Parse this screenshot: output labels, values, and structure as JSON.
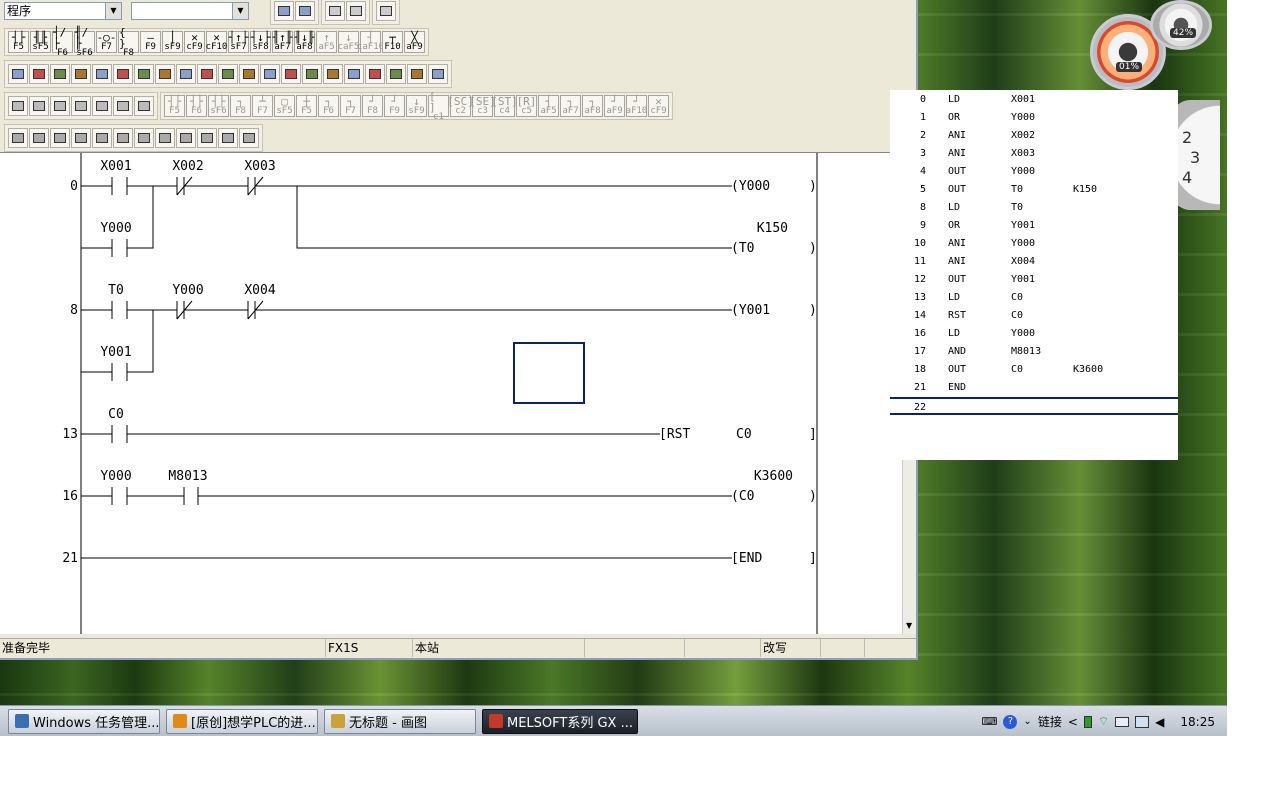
{
  "toolbar": {
    "combo_mode": "程序",
    "combo2": "",
    "ladder_keys": [
      {
        "glyph": "┤├",
        "label": "F5"
      },
      {
        "glyph": "╢╟",
        "label": "sF5"
      },
      {
        "glyph": "┤/├",
        "label": "F6"
      },
      {
        "glyph": "╢/╟",
        "label": "sF6"
      },
      {
        "glyph": "-○-",
        "label": "F7"
      },
      {
        "glyph": "{ }",
        "label": "F8"
      },
      {
        "glyph": "—",
        "label": "F9"
      },
      {
        "glyph": "│",
        "label": "sF9"
      },
      {
        "glyph": "✕",
        "label": "cF9"
      },
      {
        "glyph": "✕",
        "label": "cF10"
      },
      {
        "glyph": "┤↑├",
        "label": "sF7"
      },
      {
        "glyph": "┤↓├",
        "label": "sF8"
      },
      {
        "glyph": "╢↑╟",
        "label": "aF7"
      },
      {
        "glyph": "╢↓╟",
        "label": "aF8"
      },
      {
        "glyph": "↑",
        "label": "aF5"
      },
      {
        "glyph": "↓",
        "label": "caF5"
      },
      {
        "glyph": "┤",
        "label": "caF10"
      },
      {
        "glyph": "┬",
        "label": "F10"
      },
      {
        "glyph": "╳",
        "label": "aF9"
      }
    ],
    "edit_keys": [
      {
        "glyph": "┤├",
        "label": "F5"
      },
      {
        "glyph": "┤├",
        "label": "F6"
      },
      {
        "glyph": "┤├",
        "label": "sF6"
      },
      {
        "glyph": "┐",
        "label": "F8"
      },
      {
        "glyph": "┴",
        "label": "F7"
      },
      {
        "glyph": "▢",
        "label": "sF5"
      },
      {
        "glyph": "┼",
        "label": "F5"
      },
      {
        "glyph": "┐",
        "label": "F6"
      },
      {
        "glyph": "┐",
        "label": "F7"
      },
      {
        "glyph": "┘",
        "label": "F8"
      },
      {
        "glyph": "┘",
        "label": "F9"
      },
      {
        "glyph": "↓",
        "label": "sF9"
      },
      {
        "glyph": "[ ]",
        "label": "c1"
      },
      {
        "glyph": "[SC]",
        "label": "c2"
      },
      {
        "glyph": "[SE]",
        "label": "c3"
      },
      {
        "glyph": "[ST]",
        "label": "c4"
      },
      {
        "glyph": "[R]",
        "label": "c5"
      },
      {
        "glyph": "┤",
        "label": "aF5"
      },
      {
        "glyph": "┐",
        "label": "aF7"
      },
      {
        "glyph": "┐",
        "label": "aF8"
      },
      {
        "glyph": "┘",
        "label": "aF9"
      },
      {
        "glyph": "┘",
        "label": "aF10"
      },
      {
        "glyph": "✕",
        "label": "cF9"
      }
    ]
  },
  "ladder": {
    "rungs": [
      {
        "step": "0",
        "contacts": [
          "X001",
          "X002",
          "X003",
          "Y000"
        ],
        "coils": [
          "(Y000",
          "(T0"
        ],
        "constant": "K150"
      },
      {
        "step": "8",
        "contacts": [
          "T0",
          "Y000",
          "X004",
          "Y001"
        ],
        "coils": [
          "(Y001"
        ]
      },
      {
        "step": "13",
        "contacts": [
          "C0"
        ],
        "instruction": "[RST",
        "operand": "C0"
      },
      {
        "step": "16",
        "contacts": [
          "Y000",
          "M8013"
        ],
        "coils": [
          "(C0"
        ],
        "constant": "K3600"
      },
      {
        "step": "21",
        "instruction": "[END"
      }
    ],
    "close_paren": ")",
    "close_bracket": "]"
  },
  "instruction_list": [
    {
      "step": "0",
      "op": "LD",
      "dev": "X001",
      "k": ""
    },
    {
      "step": "1",
      "op": "OR",
      "dev": "Y000",
      "k": ""
    },
    {
      "step": "2",
      "op": "ANI",
      "dev": "X002",
      "k": ""
    },
    {
      "step": "3",
      "op": "ANI",
      "dev": "X003",
      "k": ""
    },
    {
      "step": "4",
      "op": "OUT",
      "dev": "Y000",
      "k": ""
    },
    {
      "step": "5",
      "op": "OUT",
      "dev": "T0",
      "k": "K150"
    },
    {
      "step": "8",
      "op": "LD",
      "dev": "T0",
      "k": ""
    },
    {
      "step": "9",
      "op": "OR",
      "dev": "Y001",
      "k": ""
    },
    {
      "step": "10",
      "op": "ANI",
      "dev": "Y000",
      "k": ""
    },
    {
      "step": "11",
      "op": "ANI",
      "dev": "X004",
      "k": ""
    },
    {
      "step": "12",
      "op": "OUT",
      "dev": "Y001",
      "k": ""
    },
    {
      "step": "13",
      "op": "LD",
      "dev": "C0",
      "k": ""
    },
    {
      "step": "14",
      "op": "RST",
      "dev": "C0",
      "k": ""
    },
    {
      "step": "16",
      "op": "LD",
      "dev": "Y000",
      "k": ""
    },
    {
      "step": "17",
      "op": "AND",
      "dev": "M8013",
      "k": ""
    },
    {
      "step": "18",
      "op": "OUT",
      "dev": "C0",
      "k": "K3600"
    },
    {
      "step": "21",
      "op": "END",
      "dev": "",
      "k": ""
    },
    {
      "step": "22",
      "op": "",
      "dev": "",
      "k": ""
    }
  ],
  "status": {
    "message": "准备完毕",
    "plc_type": "FX1S",
    "station": "本站",
    "mode": "改写"
  },
  "gadget": {
    "cpu": "01%",
    "memory": "42%",
    "clock_digits": [
      "2",
      "3",
      "4"
    ]
  },
  "taskbar": {
    "tasks": [
      {
        "label": "Windows 任务管理...",
        "active": false,
        "color": "#3c6fb0"
      },
      {
        "label": "[原创]想学PLC的进...",
        "active": false,
        "color": "#e08a1a"
      },
      {
        "label": "无标题 - 画图",
        "active": false,
        "color": "#c9a23a"
      },
      {
        "label": "MELSOFT系列 GX ...",
        "active": true,
        "color": "#c43a2a"
      }
    ],
    "links_label": "链接",
    "time": "18:25"
  }
}
